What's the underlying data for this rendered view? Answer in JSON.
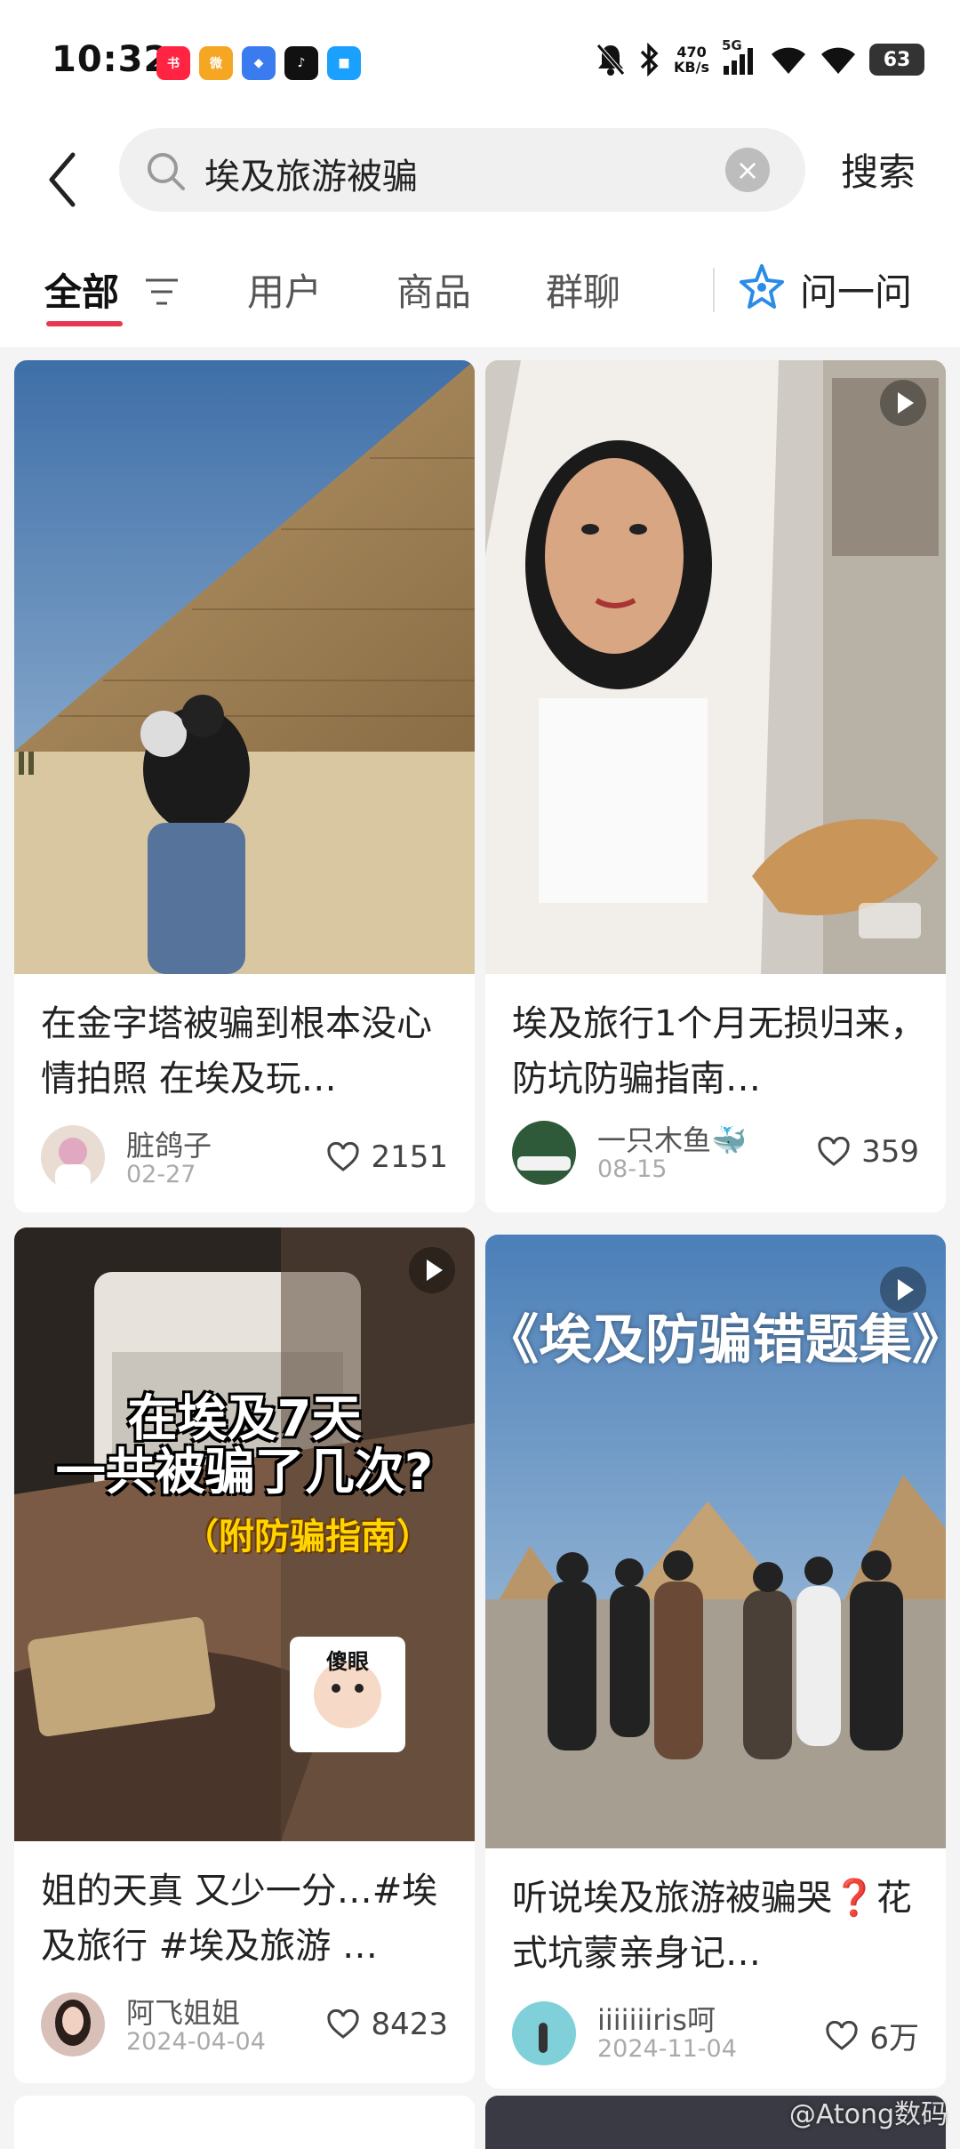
{
  "status_bar": {
    "time": "10:32",
    "net_speed_value": "470",
    "net_speed_unit": "KB/s",
    "network": "5G",
    "battery": "63",
    "app_icons": [
      "xiaohongshu-icon",
      "weibo-icon",
      "app-icon",
      "tiktok-icon",
      "app-icon"
    ]
  },
  "search": {
    "query": "埃及旅游被骗",
    "submit_label": "搜索"
  },
  "tabs": [
    {
      "label": "全部",
      "active": true
    },
    {
      "label": "用户",
      "active": false
    },
    {
      "label": "商品",
      "active": false
    },
    {
      "label": "群聊",
      "active": false
    }
  ],
  "ask": {
    "label": "问一问"
  },
  "posts": [
    {
      "title": "在金字塔被骗到根本没心情拍照 在埃及玩…",
      "author": "脏鸽子",
      "date": "02-27",
      "likes": "2151",
      "video": false
    },
    {
      "title": "埃及旅行1个月无损归来，防坑防骗指南…",
      "author": "一只木鱼🐳",
      "date": "08-15",
      "likes": "359",
      "video": true
    },
    {
      "title": "姐的天真 又少一分…#埃及旅行 #埃及旅游 …",
      "author": "阿飞姐姐",
      "date": "2024-04-04",
      "likes": "8423",
      "video": true,
      "overlay": {
        "line1": "在埃及7天",
        "line2": "一共被骗了几次?",
        "line3": "（附防骗指南）",
        "sticker": "傻眼"
      }
    },
    {
      "title": "听说埃及旅游被骗哭❓花式坑蒙亲身记…",
      "author": "iiiiiiiris呵",
      "date": "2024-11-04",
      "likes": "6万",
      "video": true,
      "overlay": {
        "line1": "《埃及防骗错题集》"
      }
    }
  ],
  "watermark": "@Atong数码",
  "colors": {
    "accent": "#e8384f",
    "ask_icon": "#2b8ce8"
  }
}
